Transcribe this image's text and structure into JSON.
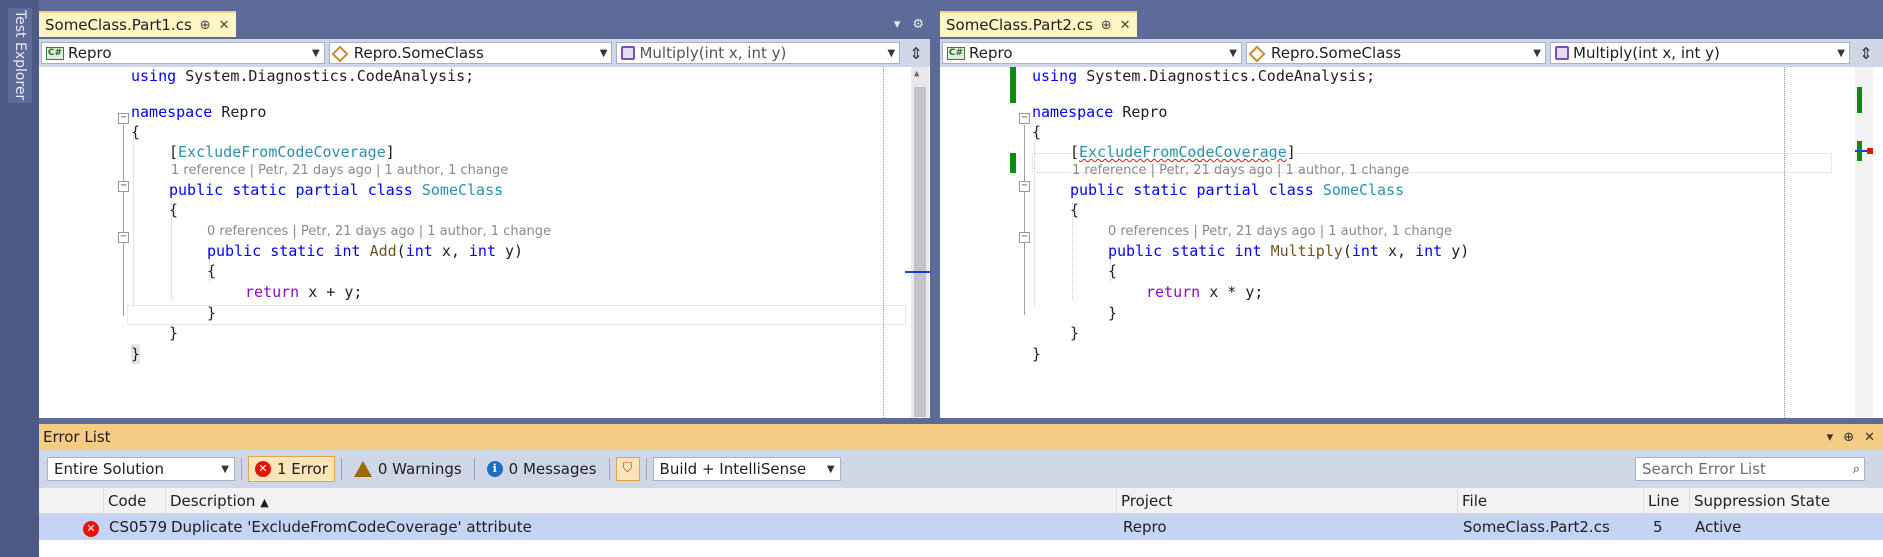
{
  "sidebar": {
    "test_explorer": "Test Explorer"
  },
  "left_pane": {
    "tab": {
      "title": "SomeClass.Part1.cs",
      "pin": "⊕",
      "close": "✕"
    },
    "tab_icons": {
      "dropdown": "▾",
      "settings": "⚙"
    },
    "nav": {
      "project": "Repro",
      "class": "Repro.SomeClass",
      "member": "Multiply(int x, int y)"
    },
    "code": {
      "using": "using",
      "using_ns": "System.Diagnostics.CodeAnalysis;",
      "namespace_kw": "namespace",
      "namespace_name": "Repro",
      "open_ns": "{",
      "attr_open": "[",
      "attr_name": "ExcludeFromCodeCoverage",
      "attr_close": "]",
      "lens_class": "1 reference | Petr, 21 days ago | 1 author, 1 change",
      "public": "public",
      "static": "static",
      "partial": "partial",
      "class_kw": "class",
      "class_name": "SomeClass",
      "open_class": "{",
      "lens_method": "0 references | Petr, 21 days ago | 1 author, 1 change",
      "int": "int",
      "method_name": "Add",
      "params_open": "(",
      "param_x": "x,",
      "param_y": "y)",
      "open_method": "{",
      "return_kw": "return",
      "return_expr": "x + y;",
      "close_method": "}",
      "close_class": "}",
      "close_ns": "}"
    }
  },
  "right_pane": {
    "tab": {
      "title": "SomeClass.Part2.cs",
      "pin": "⊕",
      "close": "✕"
    },
    "nav": {
      "project": "Repro",
      "class": "Repro.SomeClass",
      "member": "Multiply(int x, int y)"
    },
    "code": {
      "using": "using",
      "using_ns": "System.Diagnostics.CodeAnalysis;",
      "namespace_kw": "namespace",
      "namespace_name": "Repro",
      "open_ns": "{",
      "attr_open": "[",
      "attr_name": "ExcludeFromCodeCoverage",
      "attr_close": "]",
      "lens_class": "1 reference | Petr, 21 days ago | 1 author, 1 change",
      "public": "public",
      "static": "static",
      "partial": "partial",
      "class_kw": "class",
      "class_name": "SomeClass",
      "open_class": "{",
      "lens_method": "0 references | Petr, 21 days ago | 1 author, 1 change",
      "int": "int",
      "method_name": "Multiply",
      "params_open": "(",
      "param_x": "x,",
      "param_y": "y)",
      "open_method": "{",
      "return_kw": "return",
      "return_expr": "x * y;",
      "close_method": "}",
      "close_class": "}",
      "close_ns": "}"
    }
  },
  "error_list": {
    "title": "Error List",
    "title_icons": {
      "dropdown": "▾",
      "pin": "⊕",
      "close": "✕"
    },
    "scope": "Entire Solution",
    "errors_label": "1 Error",
    "warnings_label": "0 Warnings",
    "messages_label": "0 Messages",
    "build_filter": "Build + IntelliSense",
    "search_placeholder": "Search Error List",
    "columns": {
      "code": "Code",
      "description": "Description",
      "project": "Project",
      "file": "File",
      "line": "Line",
      "suppression": "Suppression State"
    },
    "rows": [
      {
        "code": "CS0579",
        "description": "Duplicate 'ExcludeFromCodeCoverage' attribute",
        "project": "Repro",
        "file": "SomeClass.Part2.cs",
        "line": "5",
        "suppression": "Active"
      }
    ]
  }
}
